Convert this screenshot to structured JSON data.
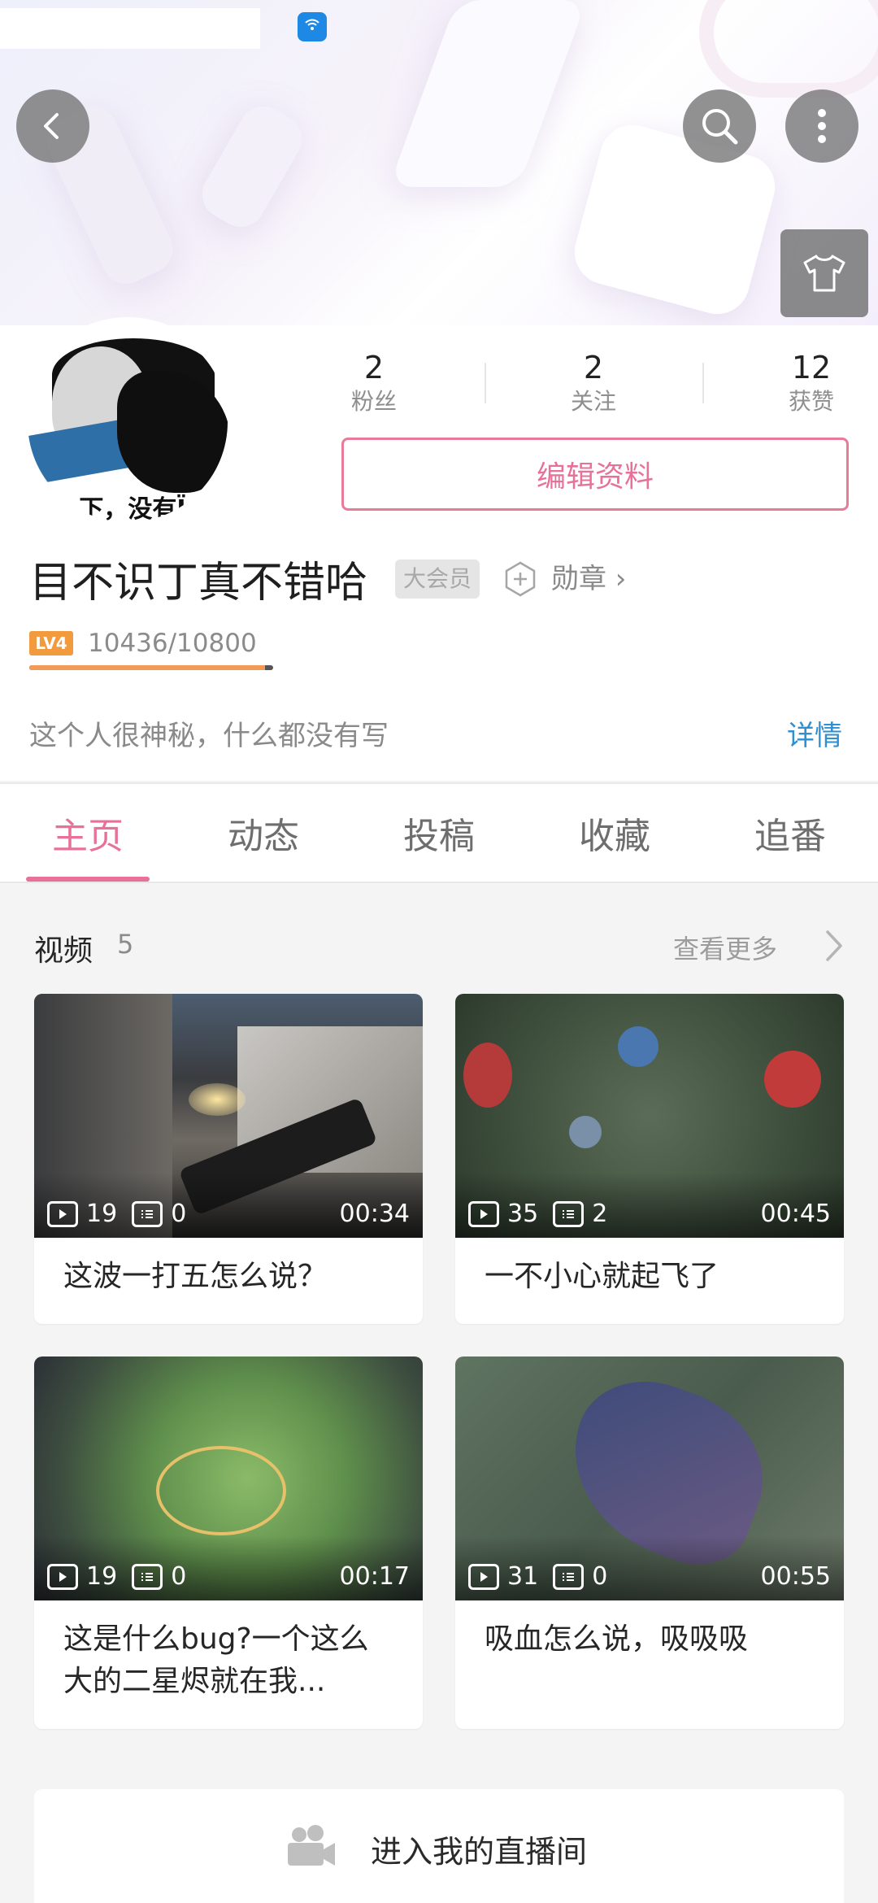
{
  "header": {
    "back_icon": "back-arrow-icon",
    "search_icon": "search-icon",
    "more_icon": "more-vertical-icon",
    "skin_icon": "tshirt-icon",
    "status_icon": "wifi-hotspot-icon"
  },
  "profile": {
    "avatar_caption": "下，没有Ï",
    "stats": [
      {
        "value": "2",
        "label": "粉丝"
      },
      {
        "value": "2",
        "label": "关注"
      },
      {
        "value": "12",
        "label": "获赞"
      }
    ],
    "edit_button": "编辑资料",
    "name": "目不识丁真不错哈",
    "vip_badge": "大会员",
    "medal_label": "勋章",
    "level": "LV4",
    "exp_text": "10436/10800",
    "exp_progress": 0.966,
    "bio": "这个人很神秘，什么都没有写",
    "detail_link": "详情"
  },
  "tabs": [
    {
      "label": "主页",
      "active": true
    },
    {
      "label": "动态",
      "active": false
    },
    {
      "label": "投稿",
      "active": false
    },
    {
      "label": "收藏",
      "active": false
    },
    {
      "label": "追番",
      "active": false
    }
  ],
  "videos": {
    "title": "视频",
    "count": "5",
    "more": "查看更多",
    "items": [
      {
        "plays": "19",
        "comments": "0",
        "duration": "00:34",
        "title": "这波一打五怎么说？"
      },
      {
        "plays": "35",
        "comments": "2",
        "duration": "00:45",
        "title": "一不小心就起飞了"
      },
      {
        "plays": "19",
        "comments": "0",
        "duration": "00:17",
        "title": "这是什么bug?一个这么大的二星烬就在我..."
      },
      {
        "plays": "31",
        "comments": "0",
        "duration": "00:55",
        "title": "吸血怎么说，吸吸吸"
      }
    ]
  },
  "live": {
    "label": "进入我的直播间"
  },
  "colors": {
    "accent_pink": "#e8719a",
    "link_blue": "#2e8fd1",
    "level_orange": "#f19a3e"
  }
}
